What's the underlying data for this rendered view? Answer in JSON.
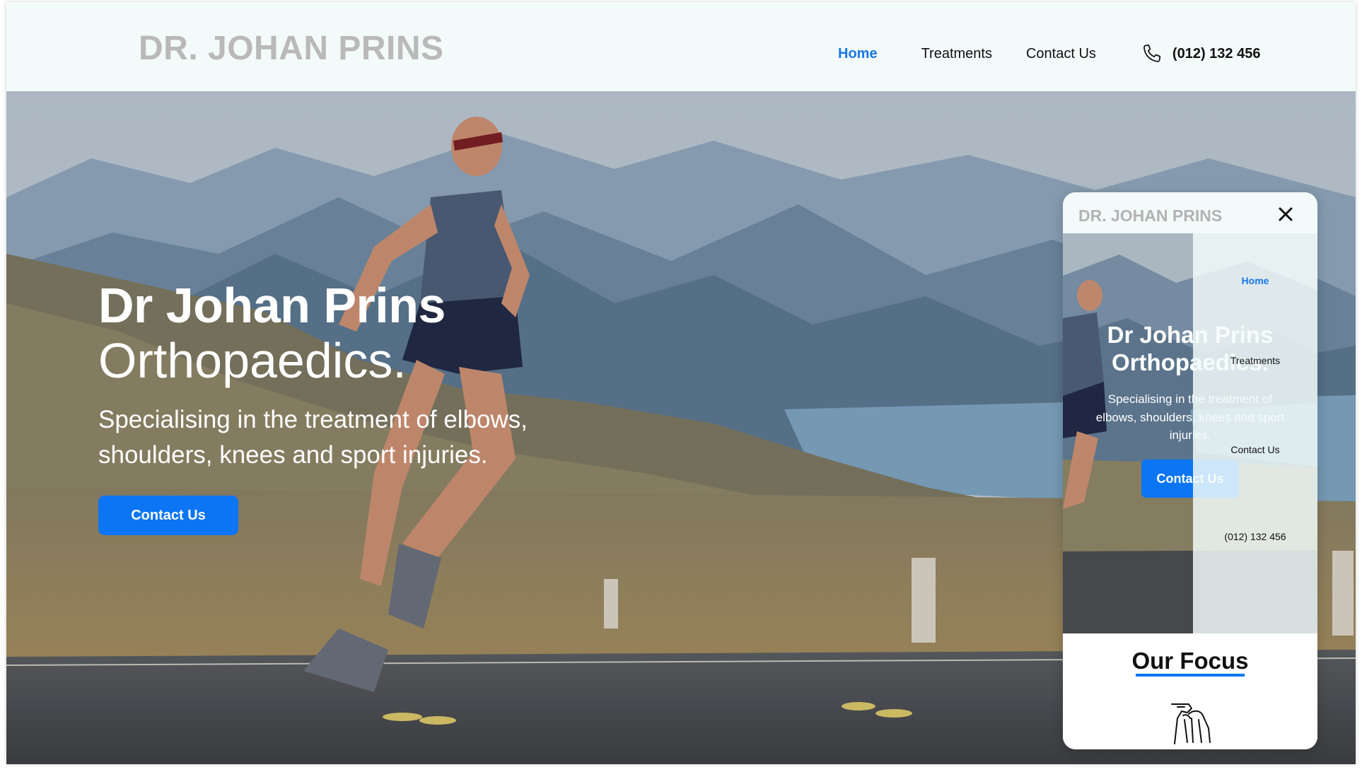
{
  "header": {
    "logo": "DR. JOHAN PRINS",
    "nav": {
      "home": "Home",
      "treatments": "Treatments",
      "contact": "Contact Us"
    },
    "phone": "(012) 132 456"
  },
  "hero": {
    "title": "Dr Johan Prins",
    "subtitle": "Orthopaedics.",
    "description": "Specialising in the treatment of elbows, shoulders, knees and sport injuries.",
    "cta": "Contact Us"
  },
  "mobile": {
    "logo": "DR. JOHAN PRINS",
    "title": "Dr Johan Prins",
    "subtitle": "Orthopaedics.",
    "description": "Specialising in the treatment of elbows, shoulders, knees and sport injuries.",
    "cta": "Contact Us",
    "menu": {
      "home": "Home",
      "treatments": "Treatments",
      "contact": "Contact Us",
      "phone": "(012) 132 456"
    },
    "focus_title": "Our Focus"
  },
  "colors": {
    "accent": "#0b75f4",
    "nav_active": "#1877e6",
    "header_bg": "#f3fbfa",
    "logo": "#b9b9b9"
  },
  "icons": {
    "phone": "phone-icon",
    "close": "close-icon",
    "focus": "shoulder-joint-icon"
  }
}
